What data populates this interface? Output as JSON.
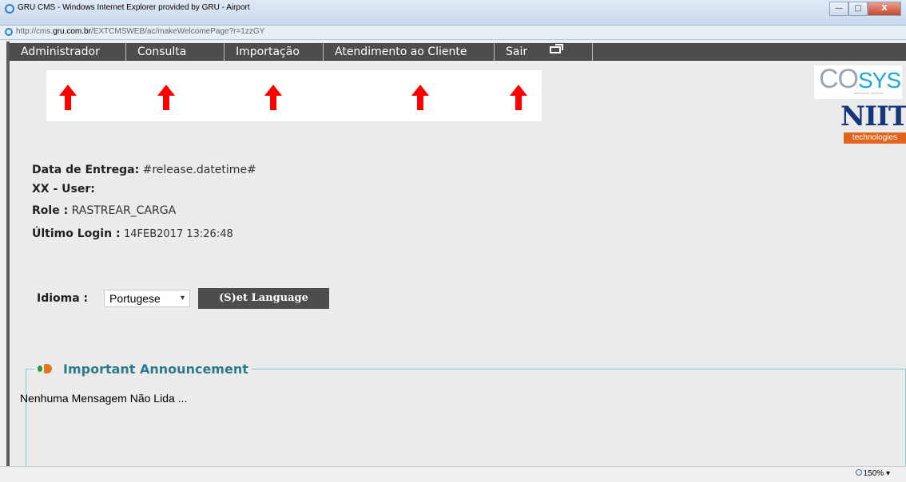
{
  "window": {
    "title": "GRU CMS - Windows Internet Explorer provided by GRU - Airport",
    "url_prefix": "http://cms.",
    "url_domain": "gru.com.br",
    "url_path": "/EXTCMSWEB/ac/makeWelcomePage?r=1zzGY"
  },
  "menu": {
    "items": [
      "Administrador",
      "Consulta",
      "Importação",
      "Atendimento ao Cliente",
      "Sair"
    ]
  },
  "logos": {
    "cosys_a": "CO",
    "cosys_b": "SYS",
    "cosys_sub": "INTELLIGENT LOGISTICS",
    "niit": "NIIT",
    "niit_sub": "technologies"
  },
  "user_info": {
    "delivery_label": "Data de Entrega:",
    "delivery_value": "#release.datetime#",
    "user_label": "XX - User:",
    "role_label": "Role :",
    "role_value": "RASTREAR_CARGA",
    "last_login_label": "Último Login :",
    "last_login_value": "14FEB2017 13:26:48"
  },
  "language": {
    "label": "Idioma :",
    "selected": "Portugese",
    "button": "(S)et Language"
  },
  "announcement": {
    "title": "Important Announcement",
    "message": "Nenhuma Mensagem Não Lida ..."
  },
  "status": {
    "zoom": "150%"
  },
  "colors": {
    "menu_bg": "#4d4d4d",
    "arrow": "#ff0000",
    "announce_title": "#2c7a8a"
  }
}
